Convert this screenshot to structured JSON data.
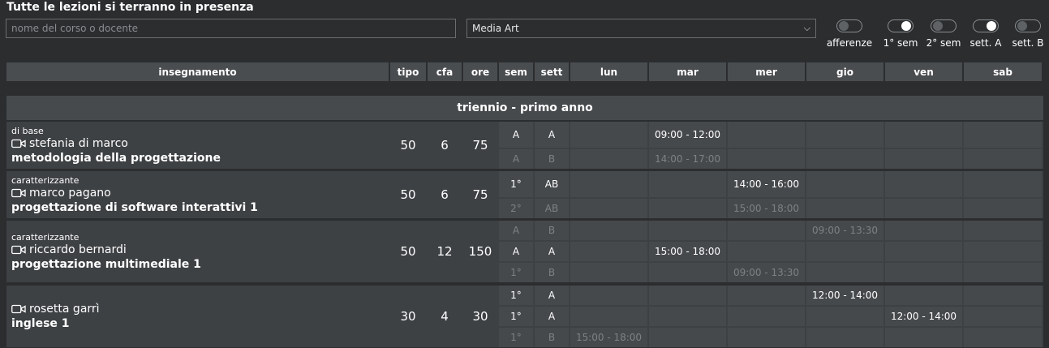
{
  "header": {
    "notice": "Tutte le lezioni si terranno in presenza",
    "search_placeholder": "nome del corso o docente",
    "program_select": "Media Art"
  },
  "toggles": [
    {
      "label": "afferenze",
      "on": false
    },
    {
      "label": "1° sem",
      "on": true
    },
    {
      "label": "2° sem",
      "on": false
    },
    {
      "label": "sett. A",
      "on": true
    },
    {
      "label": "sett. B",
      "on": false
    }
  ],
  "table": {
    "columns": [
      "insegnamento",
      "tipo",
      "cfa",
      "ore",
      "sem",
      "sett",
      "lun",
      "mar",
      "mer",
      "gio",
      "ven",
      "sab"
    ],
    "section_title": "triennio - primo anno",
    "courses": [
      {
        "category": "di base",
        "teacher": "stefania di marco",
        "name": "metodologia della progettazione",
        "tipo": "50",
        "cfa": "6",
        "ore": "75",
        "sessions": [
          {
            "sem": "A",
            "sett": "A",
            "day": "mar",
            "time": "09:00 - 12:00",
            "dim": false
          },
          {
            "sem": "A",
            "sett": "B",
            "day": "mar",
            "time": "14:00 - 17:00",
            "dim": true
          }
        ]
      },
      {
        "category": "caratterizzante",
        "teacher": "marco pagano",
        "name": "progettazione di software interattivi 1",
        "tipo": "50",
        "cfa": "6",
        "ore": "75",
        "sessions": [
          {
            "sem": "1°",
            "sett": "AB",
            "day": "mer",
            "time": "14:00 - 16:00",
            "dim": false
          },
          {
            "sem": "2°",
            "sett": "AB",
            "day": "mer",
            "time": "15:00 - 18:00",
            "dim": true
          }
        ]
      },
      {
        "category": "caratterizzante",
        "teacher": "riccardo bernardi",
        "name": "progettazione multimediale 1",
        "tipo": "50",
        "cfa": "12",
        "ore": "150",
        "sessions": [
          {
            "sem": "A",
            "sett": "B",
            "day": "gio",
            "time": "09:00 - 13:30",
            "dim": true
          },
          {
            "sem": "A",
            "sett": "A",
            "day": "mar",
            "time": "15:00 - 18:00",
            "dim": false
          },
          {
            "sem": "1°",
            "sett": "B",
            "day": "mer",
            "time": "09:00 - 13:30",
            "dim": true
          }
        ]
      },
      {
        "category": "",
        "teacher": "rosetta garrì",
        "name": "inglese 1",
        "tipo": "30",
        "cfa": "4",
        "ore": "30",
        "sessions": [
          {
            "sem": "1°",
            "sett": "A",
            "day": "gio",
            "time": "12:00 - 14:00",
            "dim": false
          },
          {
            "sem": "1°",
            "sett": "A",
            "day": "ven",
            "time": "12:00 - 14:00",
            "dim": false
          },
          {
            "sem": "1°",
            "sett": "B",
            "day": "lun",
            "time": "15:00 - 18:00",
            "dim": true
          }
        ]
      }
    ]
  },
  "colors": {
    "background": "#2b2d2f",
    "header_cell": "#4a4d50",
    "cell": "#46494c",
    "dim_text": "#7e8184"
  }
}
